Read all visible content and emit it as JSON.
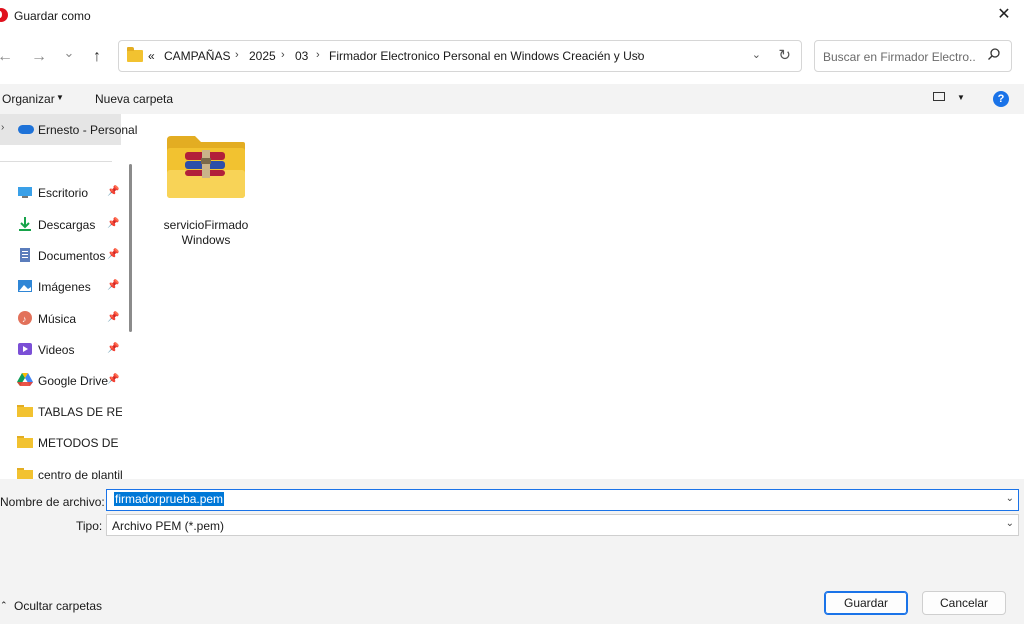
{
  "window": {
    "title": "Guardar como",
    "close_glyph": "✕"
  },
  "nav": {
    "back_glyph": "←",
    "forward_glyph": "→",
    "recent_glyph": "⌄",
    "up_glyph": "↑"
  },
  "address": {
    "overflow": "«",
    "crumbs": [
      "CAMPAÑAS",
      "2025",
      "03",
      "Firmador Electronico Personal en Windows Creacién y Uso"
    ],
    "sep": "›",
    "dropdown_glyph": "⌄",
    "refresh_glyph": "↻"
  },
  "search": {
    "placeholder": "Buscar en Firmador Electro...",
    "icon_glyph": "⚲"
  },
  "toolbar": {
    "organize": "Organizar",
    "new_folder": "Nueva carpeta",
    "help": "?"
  },
  "sidebar": {
    "onedrive": "Ernesto - Personal",
    "items": [
      {
        "label": "Escritorio",
        "icon": "desktop-icon",
        "pinned": true
      },
      {
        "label": "Descargas",
        "icon": "download-icon",
        "pinned": true
      },
      {
        "label": "Documentos",
        "icon": "documents-icon",
        "pinned": true
      },
      {
        "label": "Imágenes",
        "icon": "pictures-icon",
        "pinned": true
      },
      {
        "label": "Música",
        "icon": "music-icon",
        "pinned": true
      },
      {
        "label": "Videos",
        "icon": "videos-icon",
        "pinned": true
      },
      {
        "label": "Google Drive",
        "icon": "google-drive-icon",
        "pinned": true
      },
      {
        "label": "TABLAS DE RETENCION",
        "icon": "folder-icon",
        "pinned": false
      },
      {
        "label": "METODOS DE INVESTIGACION",
        "icon": "folder-icon",
        "pinned": false
      },
      {
        "label": "centro de plantillas",
        "icon": "folder-icon",
        "pinned": false
      }
    ]
  },
  "files": [
    {
      "name": "servicioFirmado Windows",
      "line1": "servicioFirmado",
      "line2": "Windows",
      "icon": "archive-folder-icon"
    }
  ],
  "form": {
    "filename_label": "Nombre de archivo:",
    "filename_value": "firmadorprueba.pem",
    "type_label": "Tipo:",
    "type_value": "Archivo PEM (*.pem)"
  },
  "footer": {
    "hide_folders": "Ocultar carpetas",
    "save": "Guardar",
    "cancel": "Cancelar"
  },
  "colors": {
    "accent": "#1a73e8",
    "selection": "#0078d7",
    "folder": "#f2c230"
  }
}
